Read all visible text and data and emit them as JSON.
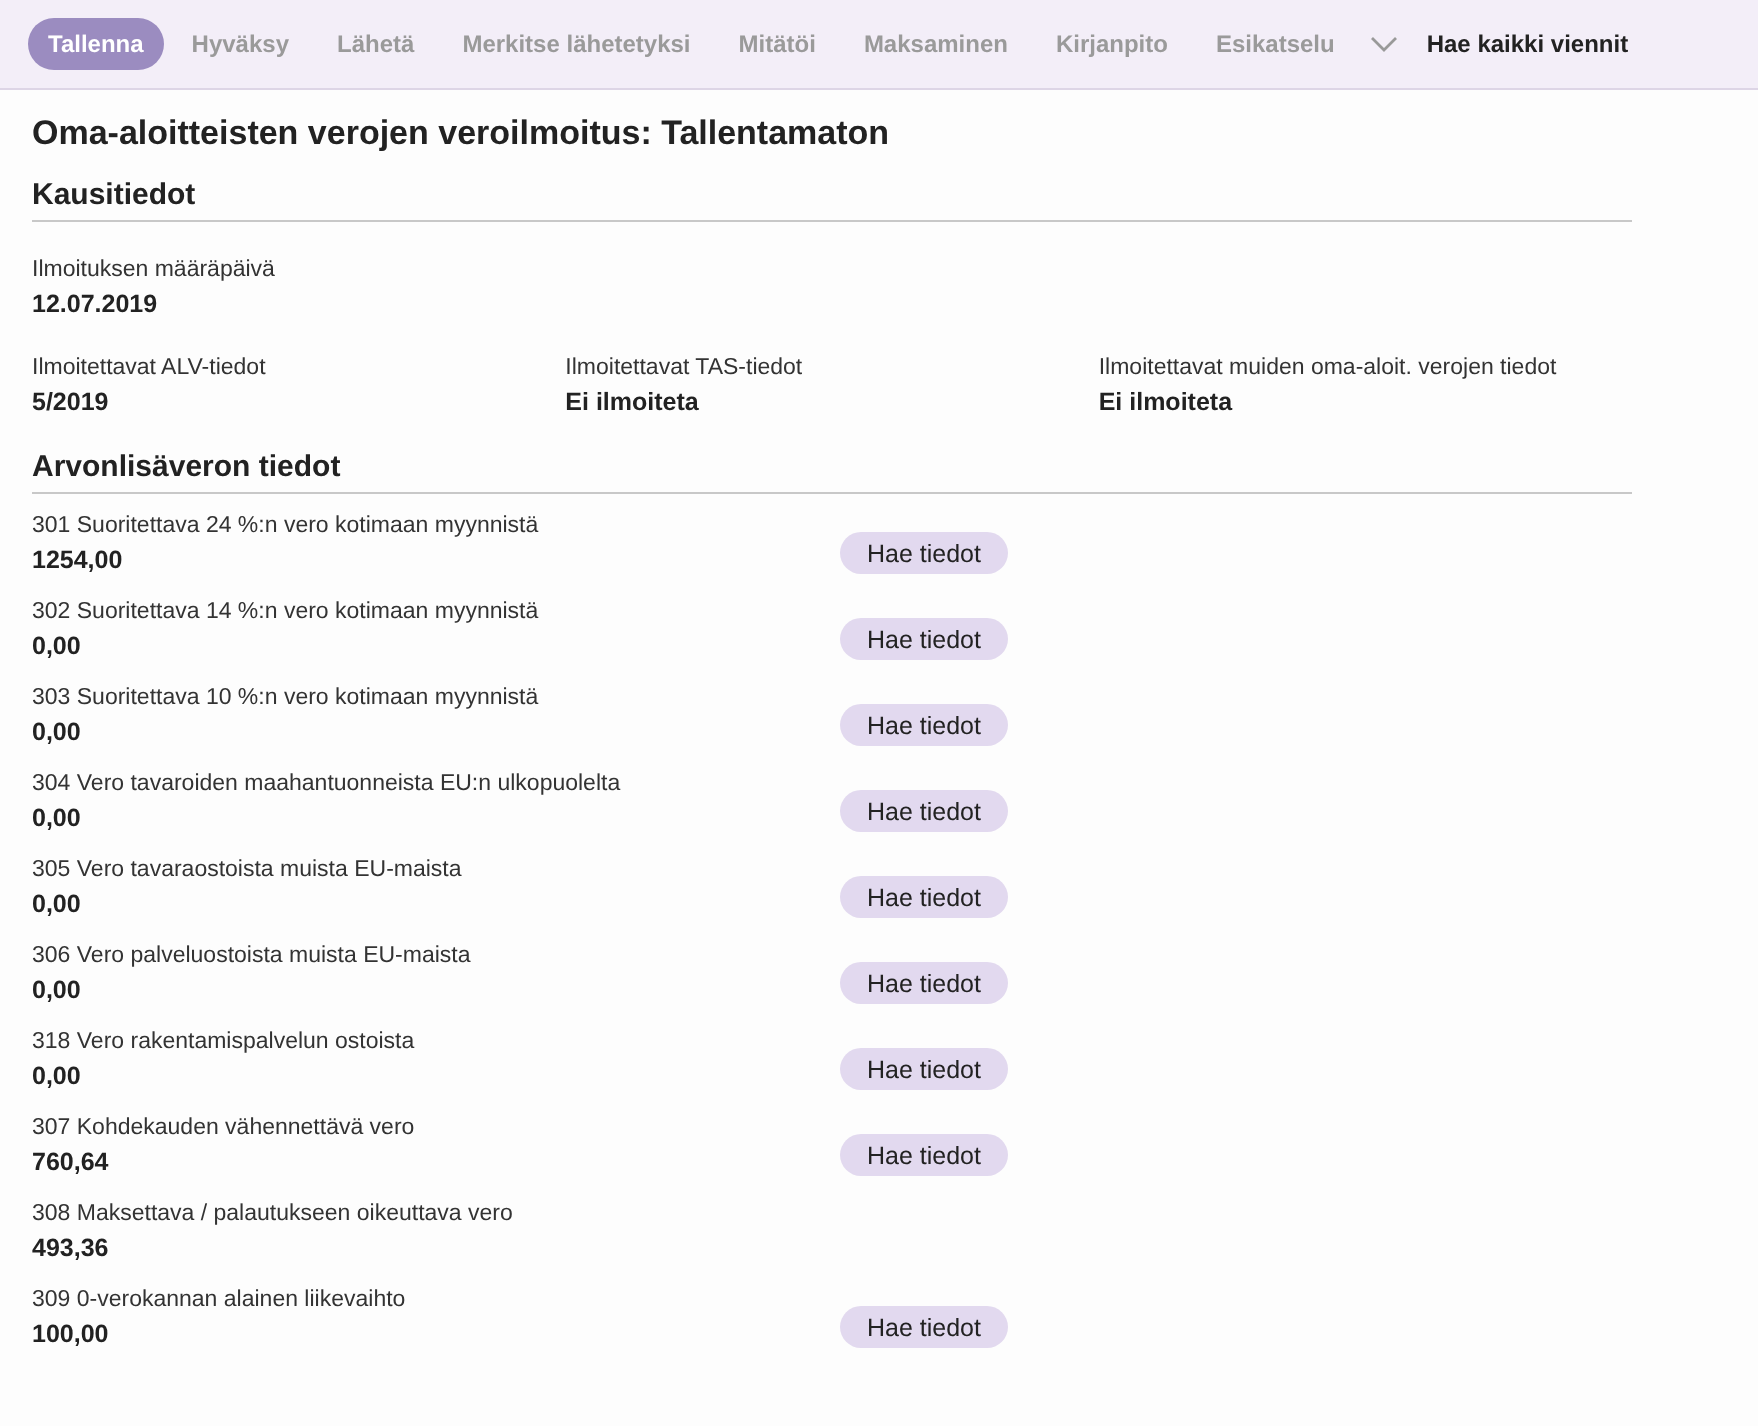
{
  "toolbar": {
    "tabs": [
      {
        "label": "Tallenna",
        "selected": true
      },
      {
        "label": "Hyväksy",
        "selected": false
      },
      {
        "label": "Lähetä",
        "selected": false
      },
      {
        "label": "Merkitse lähetetyksi",
        "selected": false
      },
      {
        "label": "Mitätöi",
        "selected": false
      },
      {
        "label": "Maksaminen",
        "selected": false
      },
      {
        "label": "Kirjanpito",
        "selected": false
      },
      {
        "label": "Esikatselu",
        "selected": false
      }
    ],
    "fetch_all": "Hae kaikki viennit"
  },
  "title": "Oma-aloitteisten verojen veroilmoitus: Tallentamaton",
  "period": {
    "heading": "Kausitiedot",
    "due_date": {
      "label": "Ilmoituksen määräpäivä",
      "value": "12.07.2019"
    },
    "fields": [
      {
        "label": "Ilmoitettavat ALV-tiedot",
        "value": "5/2019"
      },
      {
        "label": "Ilmoitettavat TAS-tiedot",
        "value": "Ei ilmoiteta"
      },
      {
        "label": "Ilmoitettavat muiden oma-aloit. verojen tiedot",
        "value": "Ei ilmoiteta"
      }
    ]
  },
  "vat": {
    "heading": "Arvonlisäveron tiedot",
    "rows": [
      {
        "label": "301 Suoritettava 24 %:n vero kotimaan myynnistä",
        "value": "1254,00",
        "button": "Hae tiedot"
      },
      {
        "label": "302 Suoritettava 14 %:n vero kotimaan myynnistä",
        "value": "0,00",
        "button": "Hae tiedot"
      },
      {
        "label": "303 Suoritettava 10 %:n vero kotimaan myynnistä",
        "value": "0,00",
        "button": "Hae tiedot"
      },
      {
        "label": "304 Vero tavaroiden maahantuonneista EU:n ulkopuolelta",
        "value": "0,00",
        "button": "Hae tiedot"
      },
      {
        "label": "305 Vero tavaraostoista muista EU-maista",
        "value": "0,00",
        "button": "Hae tiedot"
      },
      {
        "label": "306 Vero palveluostoista muista EU-maista",
        "value": "0,00",
        "button": "Hae tiedot"
      },
      {
        "label": "318 Vero rakentamispalvelun ostoista",
        "value": "0,00",
        "button": "Hae tiedot"
      },
      {
        "label": "307 Kohdekauden vähennettävä vero",
        "value": "760,64",
        "button": "Hae tiedot"
      },
      {
        "label": "308 Maksettava / palautukseen oikeuttava vero",
        "value": "493,36"
      },
      {
        "label": "309 0-verokannan alainen liikevaihto",
        "value": "100,00",
        "button": "Hae tiedot"
      }
    ]
  }
}
